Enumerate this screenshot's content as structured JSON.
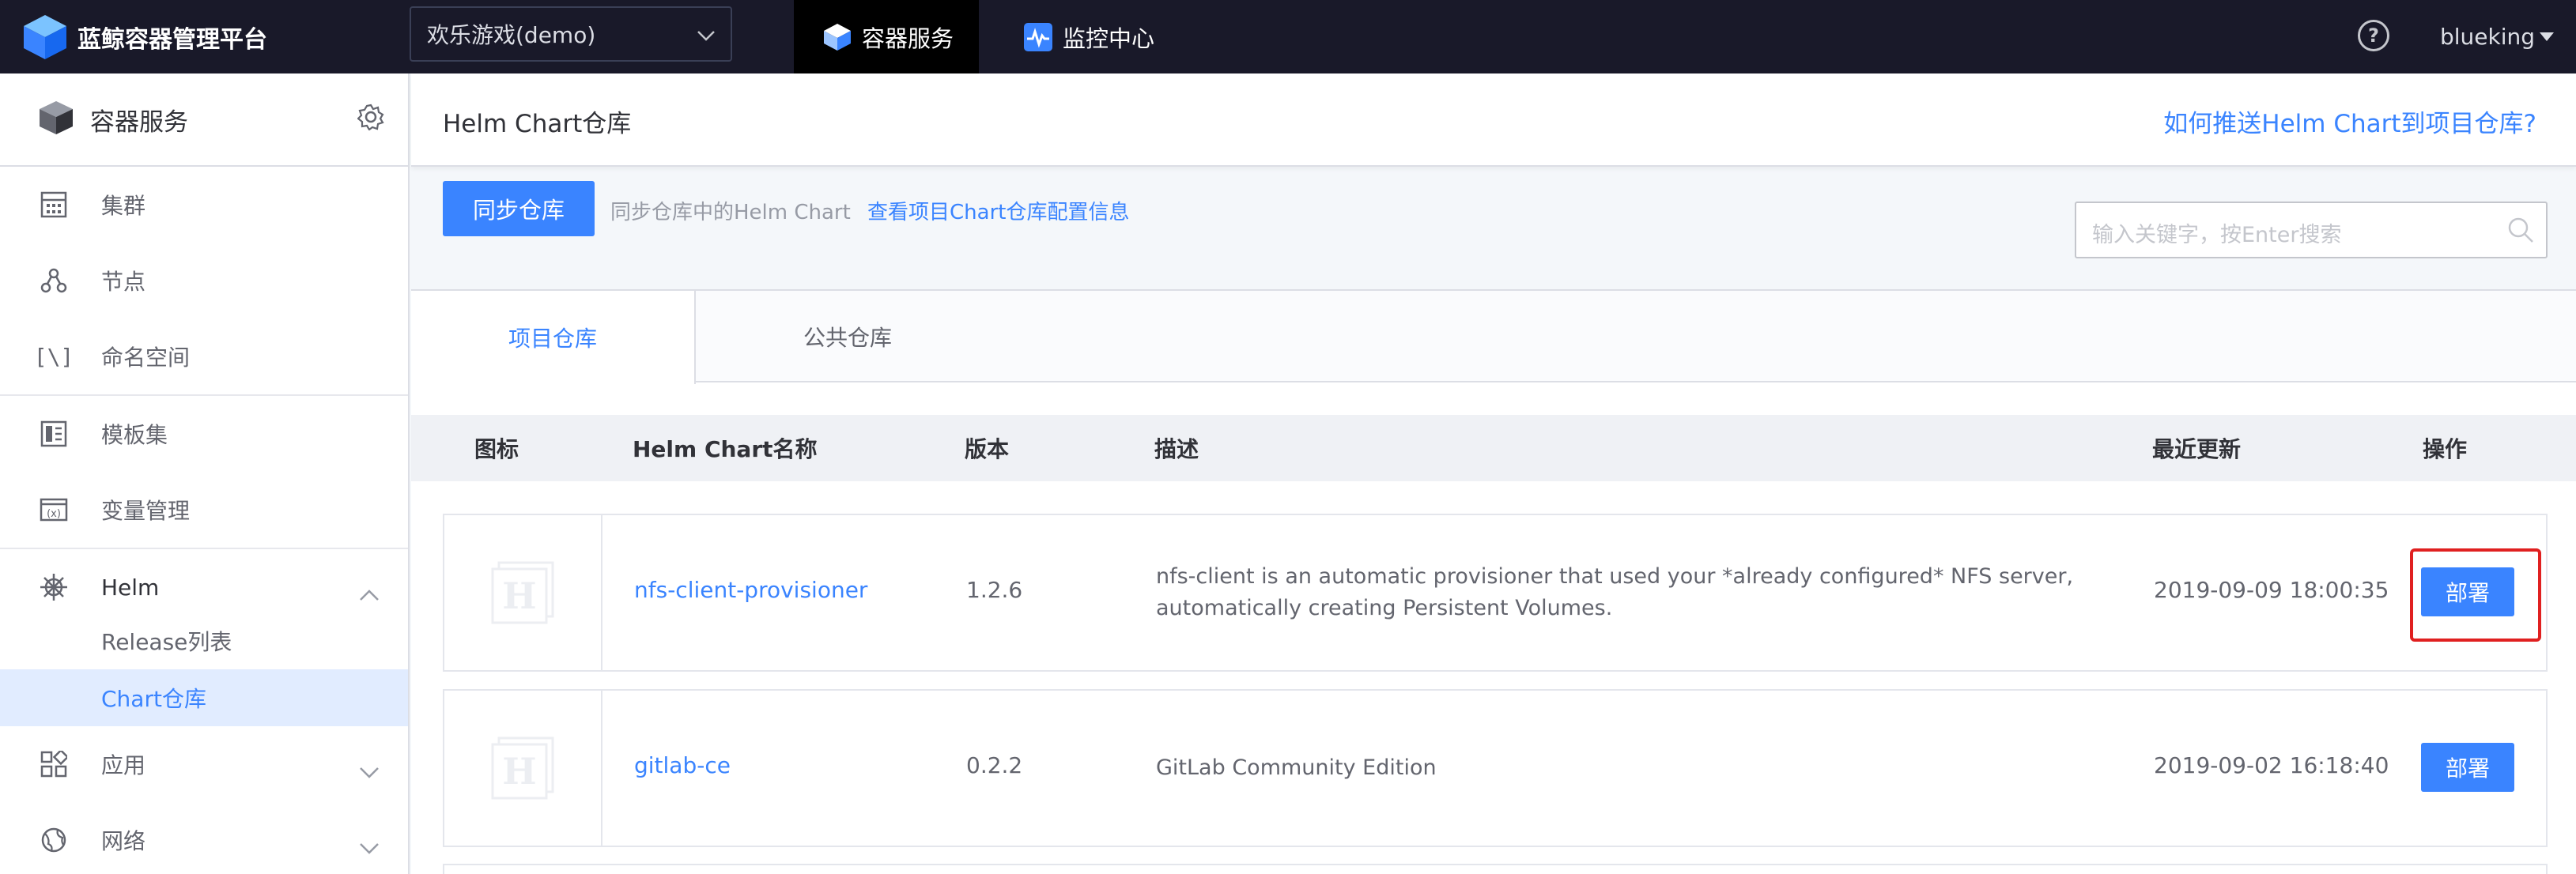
{
  "app": {
    "brand_title": "蓝鲸容器管理平台",
    "project": "欢乐游戏(demo)",
    "nav": [
      {
        "label": "容器服务",
        "icon": "cube-icon",
        "active": true
      },
      {
        "label": "监控中心",
        "icon": "monitor-icon",
        "active": false
      }
    ],
    "help_symbol": "?",
    "user": "blueking"
  },
  "sidebar": {
    "title": "容器服务",
    "items": [
      {
        "label": "集群",
        "icon": "cluster-icon"
      },
      {
        "label": "节点",
        "icon": "node-icon"
      },
      {
        "label": "命名空间",
        "icon": "namespace-icon",
        "icon_text": "[\\]"
      },
      {
        "label": "模板集",
        "icon": "template-icon"
      },
      {
        "label": "变量管理",
        "icon": "variable-icon"
      },
      {
        "label": "Helm",
        "icon": "helm-icon"
      },
      {
        "label": "应用",
        "icon": "app-icon"
      },
      {
        "label": "网络",
        "icon": "network-icon"
      }
    ],
    "helm_sub": [
      {
        "label": "Release列表",
        "active": false
      },
      {
        "label": "Chart仓库",
        "active": true
      }
    ]
  },
  "page": {
    "title": "Helm Chart仓库",
    "help_link": "如何推送Helm Chart到项目仓库?",
    "sync_button": "同步仓库",
    "sync_hint": "同步仓库中的Helm Chart",
    "config_link": "查看项目Chart仓库配置信息",
    "search_placeholder": "输入关键字，按Enter搜索",
    "tabs": [
      "项目仓库",
      "公共仓库"
    ],
    "columns": [
      "图标",
      "Helm Chart名称",
      "版本",
      "描述",
      "最近更新",
      "操作"
    ],
    "rows": [
      {
        "name": "nfs-client-provisioner",
        "version": "1.2.6",
        "desc_line1": "nfs-client is an automatic provisioner that used your *already configured* NFS server,",
        "desc_line2": "automatically creating Persistent Volumes.",
        "updated": "2019-09-09 18:00:35",
        "action": "部署"
      },
      {
        "name": "gitlab-ce",
        "version": "0.2.2",
        "desc_line1": "GitLab Community Edition",
        "desc_line2": "",
        "updated": "2019-09-02 16:18:40",
        "action": "部署"
      }
    ],
    "chart_icon_letter": "H"
  },
  "colors": {
    "topbar": "#191929",
    "accent": "#3a84ff",
    "highlight": "#e02020"
  }
}
